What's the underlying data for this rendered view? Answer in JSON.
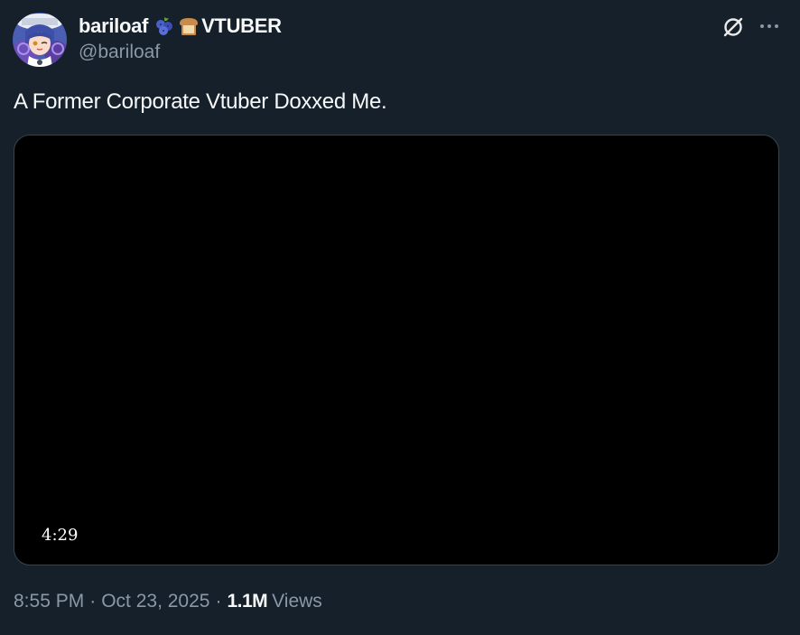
{
  "author": {
    "display_name": "bariloaf",
    "name_suffix": "VTUBER",
    "handle": "@bariloaf",
    "emoji": [
      "blueberries-icon",
      "bread-icon"
    ]
  },
  "tweet": {
    "text": "A Former Corporate Vtuber Doxxed Me.",
    "video_duration": "4:29"
  },
  "meta": {
    "time": "8:55 PM",
    "date": "Oct 23, 2025",
    "separator": "·",
    "views_count": "1.1M",
    "views_label": "Views"
  },
  "icons": {
    "grok": "grok-icon",
    "more": "more-dots-icon"
  },
  "colors": {
    "background": "#15202b",
    "primary_text": "#f7f9f9",
    "secondary_text": "#8b98a5",
    "video_background": "#000000",
    "video_border": "#38444d"
  }
}
